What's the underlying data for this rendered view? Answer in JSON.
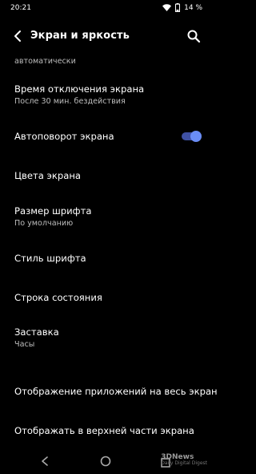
{
  "status_bar": {
    "time": "20:21",
    "battery_text": "14 %",
    "icons": [
      "wifi-icon",
      "battery-icon"
    ]
  },
  "toolbar": {
    "title": "Экран и яркость",
    "icons": [
      "back-arrow-icon",
      "search-icon"
    ]
  },
  "partial_item": {
    "subtitle": "автоматически"
  },
  "items": [
    {
      "title": "Время отключения экрана",
      "subtitle": "После 30 мин. бездействия"
    },
    {
      "title": "Автоповорот экрана",
      "toggle_on": true
    },
    {
      "title": "Цвета экрана"
    },
    {
      "title": "Размер шрифта",
      "subtitle": "По умолчанию"
    },
    {
      "title": "Стиль шрифта"
    },
    {
      "title": "Строка состояния"
    },
    {
      "title": "Заставка",
      "subtitle": "Часы"
    },
    {
      "title": "Отображение приложений на весь экран"
    },
    {
      "title": "Отображать в верхней части экрана"
    }
  ],
  "accent_color": "#6a8df5",
  "nav_bar": {
    "icons": [
      "nav-back-icon",
      "nav-home-icon",
      "nav-recent-icon"
    ]
  },
  "watermark": {
    "logo": "3DNews",
    "tagline": "Daily Digital Digest"
  }
}
